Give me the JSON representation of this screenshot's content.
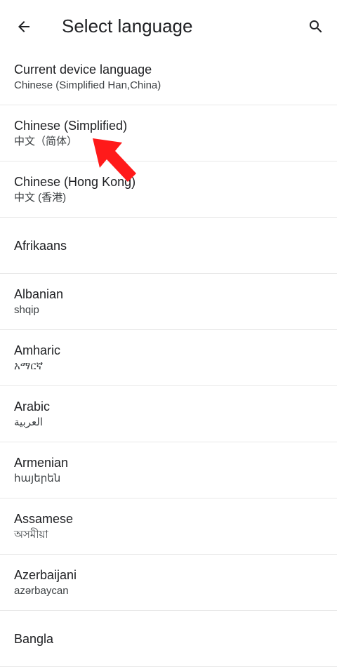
{
  "app_bar": {
    "title": "Select language",
    "back_icon": "arrow-back-icon",
    "search_icon": "search-icon"
  },
  "languages": [
    {
      "name": "Current device language",
      "native": "Chinese (Simplified Han,China)"
    },
    {
      "name": "Chinese (Simplified)",
      "native": "中文（简体）"
    },
    {
      "name": "Chinese (Hong Kong)",
      "native": "中文 (香港)"
    },
    {
      "name": "Afrikaans",
      "native": ""
    },
    {
      "name": "Albanian",
      "native": "shqip"
    },
    {
      "name": "Amharic",
      "native": "አማርኛ"
    },
    {
      "name": "Arabic",
      "native": "العربية"
    },
    {
      "name": "Armenian",
      "native": "հայերեն"
    },
    {
      "name": "Assamese",
      "native": "অসমীয়া"
    },
    {
      "name": "Azerbaijani",
      "native": "azərbaycan"
    },
    {
      "name": "Bangla",
      "native": ""
    }
  ],
  "colors": {
    "annotation_arrow": "#ff1a1a"
  }
}
